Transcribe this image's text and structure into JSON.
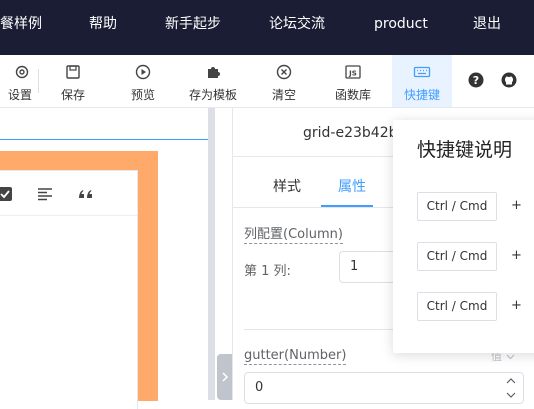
{
  "nav": {
    "items": [
      "餐样例",
      "帮助",
      "新手起步",
      "论坛交流",
      "product",
      "退出"
    ]
  },
  "toolbar": {
    "items": [
      {
        "label": "设置",
        "icon": "gear-icon"
      },
      {
        "label": "保存",
        "icon": "save-icon"
      },
      {
        "label": "预览",
        "icon": "play-circle-icon"
      },
      {
        "label": "存为模板",
        "icon": "puzzle-icon"
      },
      {
        "label": "清空",
        "icon": "close-circle-icon"
      },
      {
        "label": "函数库",
        "icon": "js-icon"
      },
      {
        "label": "快捷键",
        "icon": "keyboard-icon"
      }
    ],
    "help_icon": "question-circle-icon",
    "github_icon": "github-icon"
  },
  "editor": {
    "icons": [
      "check-square-icon",
      "align-left-icon",
      "quote-icon"
    ]
  },
  "panel": {
    "title": "grid-e23b42b",
    "tabs": [
      {
        "label": "样式"
      },
      {
        "label": "属性"
      }
    ],
    "active_tab": "属性",
    "columns_label": "列配置(Column)",
    "column_item_label": "第 1 列:",
    "column_item_value": "1",
    "gutter_label": "gutter(Number)",
    "gutter_value": "0",
    "value_toggle": "值"
  },
  "shortcuts": {
    "title": "快捷键说明",
    "keys": [
      "Ctrl / Cmd",
      "Ctrl / Cmd",
      "Ctrl / Cmd"
    ],
    "plus": "+"
  },
  "colors": {
    "nav_bg": "#1a1d33",
    "accent": "#409eff",
    "frame": "#ffa96b",
    "active_bg": "#e8f3ff"
  }
}
